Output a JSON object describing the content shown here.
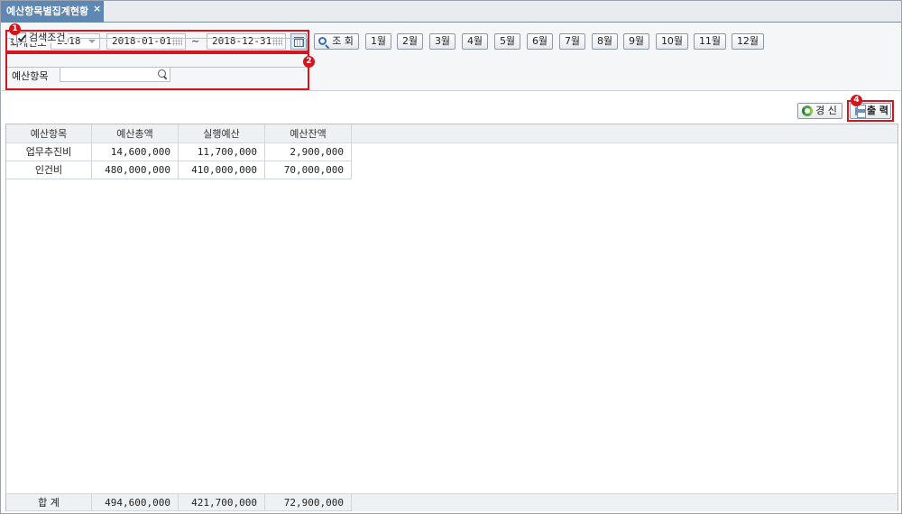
{
  "tab": {
    "title": "예산항목별집계현황",
    "close": "×"
  },
  "search": {
    "fiscal_year_label": "회계연도",
    "fiscal_year_value": "2018",
    "date_from": "2018-01-01",
    "date_sep": "~",
    "date_to": "2018-12-31",
    "query_button": "조 회",
    "months": [
      "1월",
      "2월",
      "3월",
      "4월",
      "5월",
      "6월",
      "7월",
      "8월",
      "9월",
      "10월",
      "11월",
      "12월"
    ],
    "conditions_legend": "검색조건",
    "budget_item_label": "예산항목",
    "budget_item_value": ""
  },
  "callouts": [
    "1",
    "2",
    "4"
  ],
  "toolbar": {
    "refresh": "경 신",
    "print": "출 력"
  },
  "grid": {
    "columns": [
      "예산항목",
      "예산총액",
      "실행예산",
      "예산잔액"
    ],
    "rows": [
      [
        "업무추진비",
        "14,600,000",
        "11,700,000",
        "2,900,000"
      ],
      [
        "인건비",
        "480,000,000",
        "410,000,000",
        "70,000,000"
      ]
    ],
    "footer": [
      "합 계",
      "494,600,000",
      "421,700,000",
      "72,900,000"
    ]
  },
  "colors": {
    "tab": "#5e88b3",
    "callout": "#d4161c",
    "header": "#eef1f4"
  },
  "icons": [
    "close-icon",
    "chevron-down-icon",
    "date-grid-icon",
    "calendar-icon",
    "search-icon",
    "checkbox-icon",
    "magnifier-icon",
    "refresh-icon",
    "printer-icon"
  ]
}
